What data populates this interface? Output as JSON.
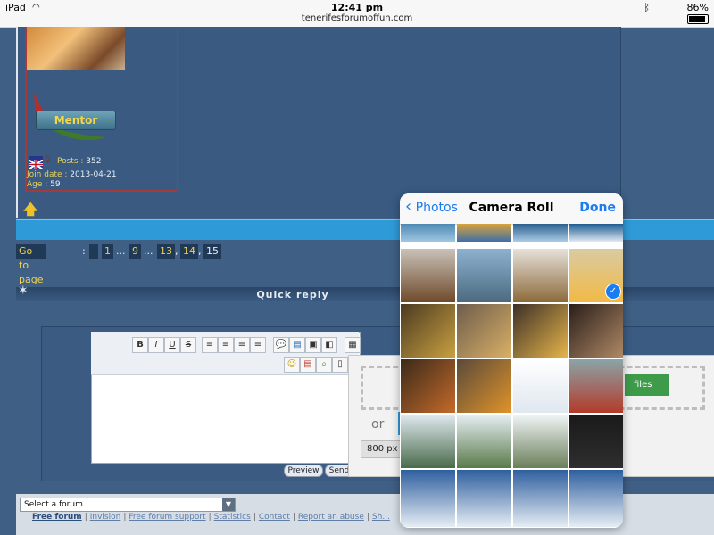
{
  "status_bar": {
    "device": "iPad",
    "time": "12:41 pm",
    "url": "tenerifesforumoffun.com",
    "battery": "86%"
  },
  "profile": {
    "rank": "Mentor",
    "posts_label": "Posts",
    "posts_value": "352",
    "joindate_label": "Join date",
    "joindate_value": "2013-04-21",
    "age_label": "Age",
    "age_value": "59"
  },
  "pagination": {
    "goto_label": "Go to page",
    "pages": [
      "1",
      "9",
      "13",
      "14",
      "15"
    ],
    "current": "15"
  },
  "quick_reply": {
    "title": "Quick reply"
  },
  "editor": {
    "buttons": [
      "B",
      "I",
      "U",
      "S"
    ],
    "preview_label": "Preview",
    "send_label": "Send"
  },
  "upload": {
    "files_label": "files",
    "or_label": "or",
    "size_label": "800 px v"
  },
  "footer": {
    "forum_select": "Select a forum",
    "links": [
      "Free forum",
      "Invision",
      "Free forum support",
      "Statistics",
      "Contact",
      "Report an abuse",
      "Sh..."
    ]
  },
  "photo_picker": {
    "back_label": "Photos",
    "title": "Camera Roll",
    "done_label": "Done"
  },
  "colors": {
    "accent": "#1a7cf2",
    "forum_bg": "#3f5f85",
    "bar_blue": "#2e9bd8",
    "rank_text": "#f4d84a"
  }
}
